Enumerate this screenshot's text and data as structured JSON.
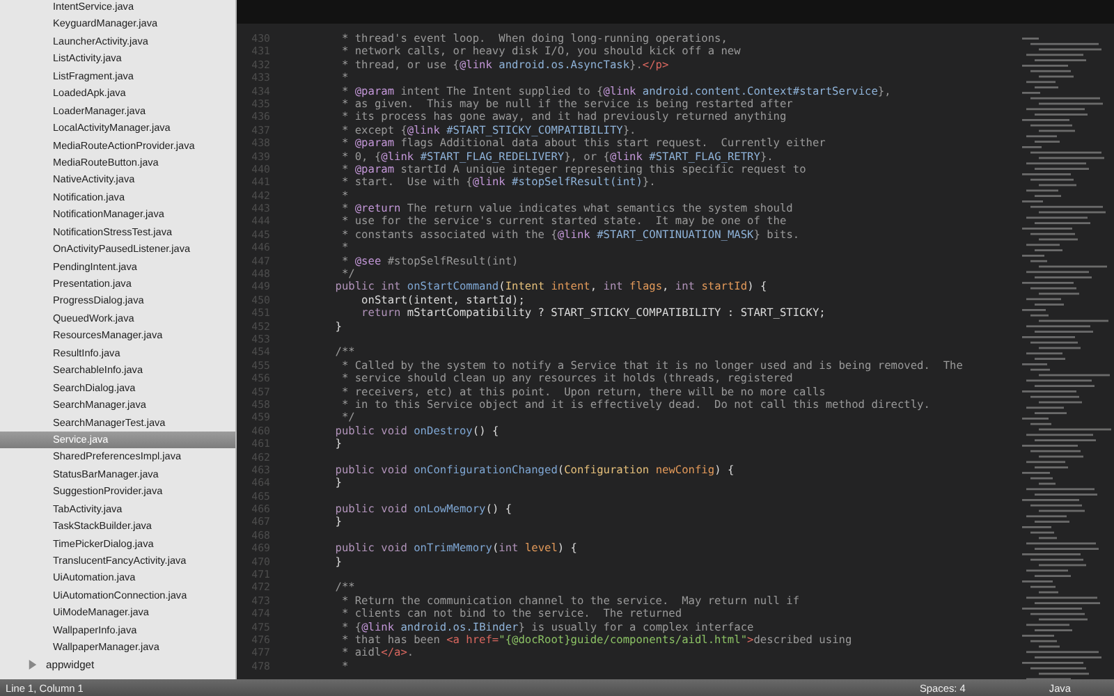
{
  "sidebar": {
    "items": [
      {
        "kind": "file",
        "label": "IntentService.java",
        "selected": false
      },
      {
        "kind": "file",
        "label": "KeyguardManager.java",
        "selected": false
      },
      {
        "kind": "file",
        "label": "LauncherActivity.java",
        "selected": false
      },
      {
        "kind": "file",
        "label": "ListActivity.java",
        "selected": false
      },
      {
        "kind": "file",
        "label": "ListFragment.java",
        "selected": false
      },
      {
        "kind": "file",
        "label": "LoadedApk.java",
        "selected": false
      },
      {
        "kind": "file",
        "label": "LoaderManager.java",
        "selected": false
      },
      {
        "kind": "file",
        "label": "LocalActivityManager.java",
        "selected": false
      },
      {
        "kind": "file",
        "label": "MediaRouteActionProvider.java",
        "selected": false
      },
      {
        "kind": "file",
        "label": "MediaRouteButton.java",
        "selected": false
      },
      {
        "kind": "file",
        "label": "NativeActivity.java",
        "selected": false
      },
      {
        "kind": "file",
        "label": "Notification.java",
        "selected": false
      },
      {
        "kind": "file",
        "label": "NotificationManager.java",
        "selected": false
      },
      {
        "kind": "file",
        "label": "NotificationStressTest.java",
        "selected": false
      },
      {
        "kind": "file",
        "label": "OnActivityPausedListener.java",
        "selected": false
      },
      {
        "kind": "file",
        "label": "PendingIntent.java",
        "selected": false
      },
      {
        "kind": "file",
        "label": "Presentation.java",
        "selected": false
      },
      {
        "kind": "file",
        "label": "ProgressDialog.java",
        "selected": false
      },
      {
        "kind": "file",
        "label": "QueuedWork.java",
        "selected": false
      },
      {
        "kind": "file",
        "label": "ResourcesManager.java",
        "selected": false
      },
      {
        "kind": "file",
        "label": "ResultInfo.java",
        "selected": false
      },
      {
        "kind": "file",
        "label": "SearchableInfo.java",
        "selected": false
      },
      {
        "kind": "file",
        "label": "SearchDialog.java",
        "selected": false
      },
      {
        "kind": "file",
        "label": "SearchManager.java",
        "selected": false
      },
      {
        "kind": "file",
        "label": "SearchManagerTest.java",
        "selected": false
      },
      {
        "kind": "file",
        "label": "Service.java",
        "selected": true
      },
      {
        "kind": "file",
        "label": "SharedPreferencesImpl.java",
        "selected": false
      },
      {
        "kind": "file",
        "label": "StatusBarManager.java",
        "selected": false
      },
      {
        "kind": "file",
        "label": "SuggestionProvider.java",
        "selected": false
      },
      {
        "kind": "file",
        "label": "TabActivity.java",
        "selected": false
      },
      {
        "kind": "file",
        "label": "TaskStackBuilder.java",
        "selected": false
      },
      {
        "kind": "file",
        "label": "TimePickerDialog.java",
        "selected": false
      },
      {
        "kind": "file",
        "label": "TranslucentFancyActivity.java",
        "selected": false
      },
      {
        "kind": "file",
        "label": "UiAutomation.java",
        "selected": false
      },
      {
        "kind": "file",
        "label": "UiAutomationConnection.java",
        "selected": false
      },
      {
        "kind": "file",
        "label": "UiModeManager.java",
        "selected": false
      },
      {
        "kind": "file",
        "label": "WallpaperInfo.java",
        "selected": false
      },
      {
        "kind": "file",
        "label": "WallpaperManager.java",
        "selected": false
      },
      {
        "kind": "folder",
        "label": "appwidget",
        "selected": false,
        "expanded": false
      }
    ]
  },
  "editor": {
    "lines": [
      {
        "number": "430",
        "tokens": [
          {
            "kind": "comment",
            "text": "     * thread's event loop.  When doing long-running operations,"
          }
        ]
      },
      {
        "number": "431",
        "tokens": [
          {
            "kind": "comment",
            "text": "     * network calls, or heavy disk I/O, you should kick off a new"
          }
        ]
      },
      {
        "number": "432",
        "tokens": [
          {
            "kind": "comment",
            "text": "     * thread, or use {"
          },
          {
            "kind": "tag",
            "text": "@link"
          },
          {
            "kind": "ref",
            "text": " android.os.AsyncTask"
          },
          {
            "kind": "comment",
            "text": "}."
          },
          {
            "kind": "html",
            "text": "</p>"
          }
        ]
      },
      {
        "number": "433",
        "tokens": [
          {
            "kind": "comment",
            "text": "     *"
          }
        ]
      },
      {
        "number": "434",
        "tokens": [
          {
            "kind": "comment",
            "text": "     * "
          },
          {
            "kind": "tag",
            "text": "@param"
          },
          {
            "kind": "comment",
            "text": " intent The Intent supplied to {"
          },
          {
            "kind": "tag",
            "text": "@link"
          },
          {
            "kind": "ref",
            "text": " android.content.Context#startService"
          },
          {
            "kind": "comment",
            "text": "},"
          }
        ]
      },
      {
        "number": "435",
        "tokens": [
          {
            "kind": "comment",
            "text": "     * as given.  This may be null if the service is being restarted after"
          }
        ]
      },
      {
        "number": "436",
        "tokens": [
          {
            "kind": "comment",
            "text": "     * its process has gone away, and it had previously returned anything"
          }
        ]
      },
      {
        "number": "437",
        "tokens": [
          {
            "kind": "comment",
            "text": "     * except {"
          },
          {
            "kind": "tag",
            "text": "@link"
          },
          {
            "kind": "ref",
            "text": " #START_STICKY_COMPATIBILITY"
          },
          {
            "kind": "comment",
            "text": "}."
          }
        ]
      },
      {
        "number": "438",
        "tokens": [
          {
            "kind": "comment",
            "text": "     * "
          },
          {
            "kind": "tag",
            "text": "@param"
          },
          {
            "kind": "comment",
            "text": " flags Additional data about this start request.  Currently either"
          }
        ]
      },
      {
        "number": "439",
        "tokens": [
          {
            "kind": "comment",
            "text": "     * 0, {"
          },
          {
            "kind": "tag",
            "text": "@link"
          },
          {
            "kind": "ref",
            "text": " #START_FLAG_REDELIVERY"
          },
          {
            "kind": "comment",
            "text": "}, or {"
          },
          {
            "kind": "tag",
            "text": "@link"
          },
          {
            "kind": "ref",
            "text": " #START_FLAG_RETRY"
          },
          {
            "kind": "comment",
            "text": "}."
          }
        ]
      },
      {
        "number": "440",
        "tokens": [
          {
            "kind": "comment",
            "text": "     * "
          },
          {
            "kind": "tag",
            "text": "@param"
          },
          {
            "kind": "comment",
            "text": " startId A unique integer representing this specific request to"
          }
        ]
      },
      {
        "number": "441",
        "tokens": [
          {
            "kind": "comment",
            "text": "     * start.  Use with {"
          },
          {
            "kind": "tag",
            "text": "@link"
          },
          {
            "kind": "ref",
            "text": " #stopSelfResult(int)"
          },
          {
            "kind": "comment",
            "text": "}."
          }
        ]
      },
      {
        "number": "442",
        "tokens": [
          {
            "kind": "comment",
            "text": "     *"
          }
        ]
      },
      {
        "number": "443",
        "tokens": [
          {
            "kind": "comment",
            "text": "     * "
          },
          {
            "kind": "tag",
            "text": "@return"
          },
          {
            "kind": "comment",
            "text": " The return value indicates what semantics the system should"
          }
        ]
      },
      {
        "number": "444",
        "tokens": [
          {
            "kind": "comment",
            "text": "     * use for the service's current started state.  It may be one of the"
          }
        ]
      },
      {
        "number": "445",
        "tokens": [
          {
            "kind": "comment",
            "text": "     * constants associated with the {"
          },
          {
            "kind": "tag",
            "text": "@link"
          },
          {
            "kind": "ref",
            "text": " #START_CONTINUATION_MASK"
          },
          {
            "kind": "comment",
            "text": "} bits."
          }
        ]
      },
      {
        "number": "446",
        "tokens": [
          {
            "kind": "comment",
            "text": "     *"
          }
        ]
      },
      {
        "number": "447",
        "tokens": [
          {
            "kind": "comment",
            "text": "     * "
          },
          {
            "kind": "tag",
            "text": "@see"
          },
          {
            "kind": "comment",
            "text": " #stopSelfResult(int)"
          }
        ]
      },
      {
        "number": "448",
        "tokens": [
          {
            "kind": "comment",
            "text": "     */"
          }
        ]
      },
      {
        "number": "449",
        "tokens": [
          {
            "kind": "keyword",
            "text": "    public int"
          },
          {
            "kind": "function",
            "text": " onStartCommand"
          },
          {
            "kind": "plain",
            "text": "("
          },
          {
            "kind": "type",
            "text": "Intent"
          },
          {
            "kind": "param",
            "text": " intent"
          },
          {
            "kind": "plain",
            "text": ", "
          },
          {
            "kind": "keyword",
            "text": "int"
          },
          {
            "kind": "param",
            "text": " flags"
          },
          {
            "kind": "plain",
            "text": ", "
          },
          {
            "kind": "keyword",
            "text": "int"
          },
          {
            "kind": "param",
            "text": " startId"
          },
          {
            "kind": "plain",
            "text": ") {"
          }
        ]
      },
      {
        "number": "450",
        "tokens": [
          {
            "kind": "plain",
            "text": "        onStart(intent, startId);"
          }
        ]
      },
      {
        "number": "451",
        "tokens": [
          {
            "kind": "keyword",
            "text": "        return"
          },
          {
            "kind": "plain",
            "text": " mStartCompatibility ? START_STICKY_COMPATIBILITY : START_STICKY;"
          }
        ]
      },
      {
        "number": "452",
        "tokens": [
          {
            "kind": "plain",
            "text": "    }"
          }
        ]
      },
      {
        "number": "453"
      },
      {
        "number": "454",
        "tokens": [
          {
            "kind": "comment",
            "text": "    /**"
          }
        ]
      },
      {
        "number": "455",
        "tokens": [
          {
            "kind": "comment",
            "text": "     * Called by the system to notify a Service that it is no longer used and is being removed.  The"
          }
        ]
      },
      {
        "number": "456",
        "tokens": [
          {
            "kind": "comment",
            "text": "     * service should clean up any resources it holds (threads, registered"
          }
        ]
      },
      {
        "number": "457",
        "tokens": [
          {
            "kind": "comment",
            "text": "     * receivers, etc) at this point.  Upon return, there will be no more calls"
          }
        ]
      },
      {
        "number": "458",
        "tokens": [
          {
            "kind": "comment",
            "text": "     * in to this Service object and it is effectively dead.  Do not call this method directly."
          }
        ]
      },
      {
        "number": "459",
        "tokens": [
          {
            "kind": "comment",
            "text": "     */"
          }
        ]
      },
      {
        "number": "460",
        "tokens": [
          {
            "kind": "keyword",
            "text": "    public void"
          },
          {
            "kind": "function",
            "text": " onDestroy"
          },
          {
            "kind": "plain",
            "text": "() {"
          }
        ]
      },
      {
        "number": "461",
        "tokens": [
          {
            "kind": "plain",
            "text": "    }"
          }
        ]
      },
      {
        "number": "462"
      },
      {
        "number": "463",
        "tokens": [
          {
            "kind": "keyword",
            "text": "    public void"
          },
          {
            "kind": "function",
            "text": " onConfigurationChanged"
          },
          {
            "kind": "plain",
            "text": "("
          },
          {
            "kind": "type",
            "text": "Configuration"
          },
          {
            "kind": "param",
            "text": " newConfig"
          },
          {
            "kind": "plain",
            "text": ") {"
          }
        ]
      },
      {
        "number": "464",
        "tokens": [
          {
            "kind": "plain",
            "text": "    }"
          }
        ]
      },
      {
        "number": "465"
      },
      {
        "number": "466",
        "tokens": [
          {
            "kind": "keyword",
            "text": "    public void"
          },
          {
            "kind": "function",
            "text": " onLowMemory"
          },
          {
            "kind": "plain",
            "text": "() {"
          }
        ]
      },
      {
        "number": "467",
        "tokens": [
          {
            "kind": "plain",
            "text": "    }"
          }
        ]
      },
      {
        "number": "468"
      },
      {
        "number": "469",
        "tokens": [
          {
            "kind": "keyword",
            "text": "    public void"
          },
          {
            "kind": "function",
            "text": " onTrimMemory"
          },
          {
            "kind": "plain",
            "text": "("
          },
          {
            "kind": "keyword",
            "text": "int"
          },
          {
            "kind": "param",
            "text": " level"
          },
          {
            "kind": "plain",
            "text": ") {"
          }
        ]
      },
      {
        "number": "470",
        "tokens": [
          {
            "kind": "plain",
            "text": "    }"
          }
        ]
      },
      {
        "number": "471"
      },
      {
        "number": "472",
        "tokens": [
          {
            "kind": "comment",
            "text": "    /**"
          }
        ]
      },
      {
        "number": "473",
        "tokens": [
          {
            "kind": "comment",
            "text": "     * Return the communication channel to the service.  May return null if"
          }
        ]
      },
      {
        "number": "474",
        "tokens": [
          {
            "kind": "comment",
            "text": "     * clients can not bind to the service.  The returned"
          }
        ]
      },
      {
        "number": "475",
        "tokens": [
          {
            "kind": "comment",
            "text": "     * {"
          },
          {
            "kind": "tag",
            "text": "@link"
          },
          {
            "kind": "ref",
            "text": " android.os.IBinder"
          },
          {
            "kind": "comment",
            "text": "} is usually for a complex interface"
          }
        ]
      },
      {
        "number": "476",
        "tokens": [
          {
            "kind": "comment",
            "text": "     * that has been "
          },
          {
            "kind": "html",
            "text": "<a href="
          },
          {
            "kind": "string",
            "text": "\"{@docRoot}guide/components/aidl.html\""
          },
          {
            "kind": "html",
            "text": ">"
          },
          {
            "kind": "comment",
            "text": "described using"
          }
        ]
      },
      {
        "number": "477",
        "tokens": [
          {
            "kind": "comment",
            "text": "     * aidl"
          },
          {
            "kind": "html",
            "text": "</a>"
          },
          {
            "kind": "comment",
            "text": "."
          }
        ]
      },
      {
        "number": "478",
        "tokens": [
          {
            "kind": "comment",
            "text": "     *"
          }
        ]
      }
    ]
  },
  "status_bar": {
    "position": "Line 1, Column 1",
    "indentation": "Spaces: 4",
    "syntax": "Java"
  }
}
